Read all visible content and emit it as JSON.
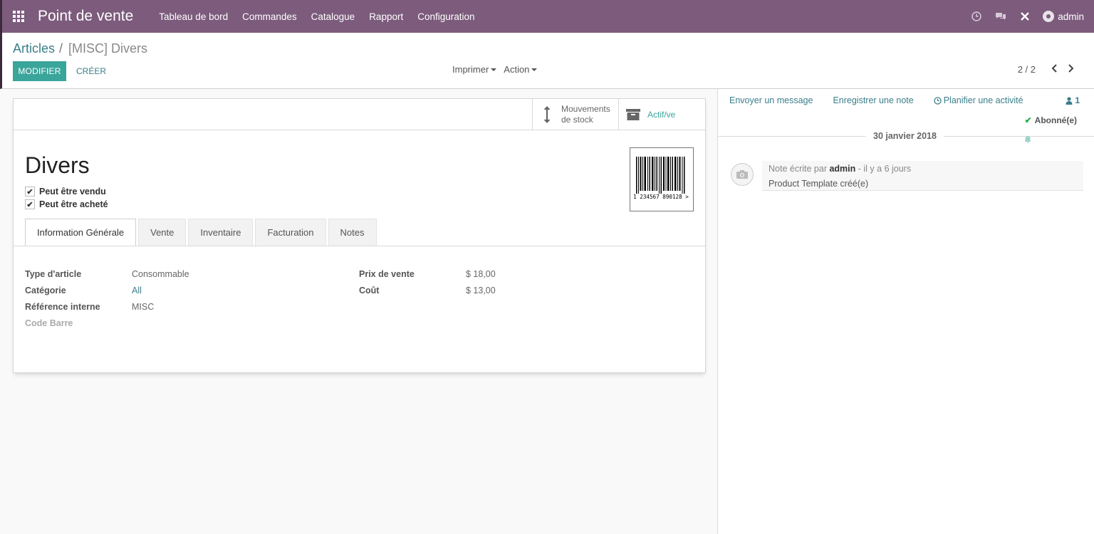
{
  "navbar": {
    "app_title": "Point de vente",
    "menu": [
      "Tableau de bord",
      "Commandes",
      "Catalogue",
      "Rapport",
      "Configuration"
    ],
    "user": "admin",
    "icons": [
      "clock-icon",
      "chat-icon",
      "close-x-icon"
    ]
  },
  "control_panel": {
    "breadcrumb_parent": "Articles",
    "breadcrumb_separator": "/",
    "breadcrumb_current": "[MISC] Divers",
    "edit_button": "MODIFIER",
    "create_button": "CRÉER",
    "print_dropdown": "Imprimer",
    "action_dropdown": "Action",
    "pager_value": "2 / 2"
  },
  "form": {
    "stock_button": {
      "line1": "Mouvements",
      "line2": "de stock"
    },
    "active_button": "Actif/ve",
    "title": "Divers",
    "checkboxes": [
      {
        "label": "Peut être vendu",
        "checked": true
      },
      {
        "label": "Peut être acheté",
        "checked": true
      }
    ],
    "barcode_text": "1 234567 890128 >",
    "tabs": [
      "Information Générale",
      "Vente",
      "Inventaire",
      "Facturation",
      "Notes"
    ],
    "active_tab": "Information Générale",
    "left_fields": [
      {
        "label": "Type d'article",
        "value": "Consommable"
      },
      {
        "label": "Catégorie",
        "value": "All"
      },
      {
        "label": "Référence interne",
        "value": "MISC"
      },
      {
        "label": "Code Barre",
        "value": ""
      }
    ],
    "right_fields": [
      {
        "label": "Prix de vente",
        "value": "$ 18,00"
      },
      {
        "label": "Coût",
        "value": "$ 13,00"
      }
    ]
  },
  "chatter": {
    "send_message": "Envoyer un message",
    "log_note": "Enregistrer une note",
    "schedule_activity": "Planifier une activité",
    "followers_count": "1",
    "subscribed": "Abonné(e)",
    "date": "30 janvier 2018",
    "message": {
      "prefix": "Note écrite par",
      "author": "admin",
      "time": "- il y a 6 jours",
      "body": "Product Template créé(e)"
    }
  },
  "colors": {
    "navbar": "#7c5b7c",
    "primary": "#3aa59b",
    "link": "#3a7e8a"
  }
}
